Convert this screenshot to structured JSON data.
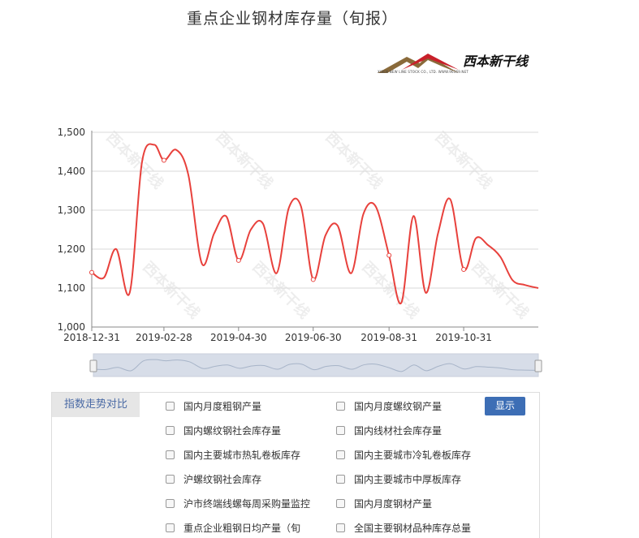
{
  "title": "重点企业钢材库存量（旬报）",
  "logo": {
    "text": "西本新干线",
    "subtitle": "XIBEN NEW LINE STOCK CO., LTD.  WWW.96369.NET"
  },
  "watermark_text": "西本新干线",
  "colors": {
    "line": "#e8413c",
    "grid": "#d9d9d9",
    "axis": "#333333",
    "navigator_fill": "#d7dde8",
    "button": "#3d6eb5",
    "tab_text": "#4a6aa5"
  },
  "chart_data": {
    "type": "line",
    "title": "重点企业钢材库存量（旬报）",
    "xlabel": "",
    "ylabel": "",
    "x_tick_labels": [
      "2018-12-31",
      "2019-02-28",
      "2019-04-30",
      "2019-06-30",
      "2019-08-31",
      "2019-10-31"
    ],
    "y_tick_labels": [
      "1,000",
      "1,100",
      "1,200",
      "1,300",
      "1,400",
      "1,500"
    ],
    "ylim": [
      1000,
      1500
    ],
    "xlim": [
      "2018-12-31",
      "2019-12-31"
    ],
    "grid": true,
    "legend": "none",
    "series": [
      {
        "values": [
          {
            "x": "2018-12-31",
            "y": 1140
          },
          {
            "x": "2019-01-10",
            "y": 1127
          },
          {
            "x": "2019-01-20",
            "y": 1200
          },
          {
            "x": "2019-01-31",
            "y": 1088
          },
          {
            "x": "2019-02-10",
            "y": 1422
          },
          {
            "x": "2019-02-20",
            "y": 1468
          },
          {
            "x": "2019-02-28",
            "y": 1428
          },
          {
            "x": "2019-03-10",
            "y": 1455
          },
          {
            "x": "2019-03-20",
            "y": 1390
          },
          {
            "x": "2019-03-31",
            "y": 1163
          },
          {
            "x": "2019-04-10",
            "y": 1240
          },
          {
            "x": "2019-04-20",
            "y": 1284
          },
          {
            "x": "2019-04-30",
            "y": 1171
          },
          {
            "x": "2019-05-10",
            "y": 1250
          },
          {
            "x": "2019-05-20",
            "y": 1265
          },
          {
            "x": "2019-05-31",
            "y": 1138
          },
          {
            "x": "2019-06-10",
            "y": 1305
          },
          {
            "x": "2019-06-20",
            "y": 1310
          },
          {
            "x": "2019-06-30",
            "y": 1122
          },
          {
            "x": "2019-07-10",
            "y": 1235
          },
          {
            "x": "2019-07-20",
            "y": 1260
          },
          {
            "x": "2019-07-31",
            "y": 1138
          },
          {
            "x": "2019-08-10",
            "y": 1290
          },
          {
            "x": "2019-08-20",
            "y": 1310
          },
          {
            "x": "2019-08-31",
            "y": 1184
          },
          {
            "x": "2019-09-10",
            "y": 1062
          },
          {
            "x": "2019-09-20",
            "y": 1285
          },
          {
            "x": "2019-09-30",
            "y": 1088
          },
          {
            "x": "2019-10-10",
            "y": 1240
          },
          {
            "x": "2019-10-20",
            "y": 1328
          },
          {
            "x": "2019-10-31",
            "y": 1148
          },
          {
            "x": "2019-11-10",
            "y": 1228
          },
          {
            "x": "2019-11-20",
            "y": 1210
          },
          {
            "x": "2019-11-30",
            "y": 1180
          },
          {
            "x": "2019-12-10",
            "y": 1120
          },
          {
            "x": "2019-12-20",
            "y": 1108
          },
          {
            "x": "2019-12-31",
            "y": 1100
          }
        ],
        "marked_points": [
          "2018-12-31",
          "2019-02-28",
          "2019-04-30",
          "2019-06-30",
          "2019-08-31",
          "2019-10-31"
        ]
      }
    ]
  },
  "panel": {
    "tab_label": "指数走势对比",
    "show_button": "显示",
    "options": [
      [
        "国内月度粗钢产量",
        "国内月度螺纹钢产量"
      ],
      [
        "国内螺纹钢社会库存量",
        "国内线材社会库存量"
      ],
      [
        "国内主要城市热轧卷板库存",
        "国内主要城市冷轧卷板库存"
      ],
      [
        "沪螺纹钢社会库存",
        "国内主要城市中厚板库存"
      ],
      [
        "沪市终端线螺每周采购量监控",
        "国内月度钢材产量"
      ],
      [
        "重点企业粗钢日均产量（旬",
        "全国主要钢材品种库存总量"
      ]
    ]
  }
}
